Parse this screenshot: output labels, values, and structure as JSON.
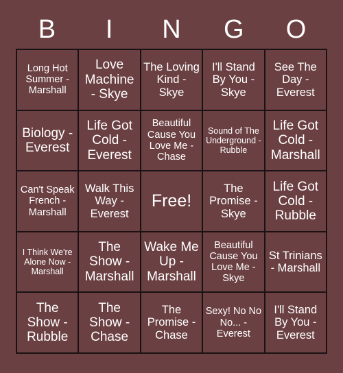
{
  "card": {
    "header_letters": [
      "B",
      "I",
      "N",
      "G",
      "O"
    ],
    "colors": {
      "background": "#6b4042",
      "cell_background": "#6b4042",
      "grid_line": "#191113",
      "text": "#ffffff"
    },
    "cells": [
      {
        "text": "Long Hot Summer - Marshall",
        "size": "sm"
      },
      {
        "text": "Love Machine - Skye",
        "size": "lg"
      },
      {
        "text": "The Loving Kind - Skye",
        "size": "md"
      },
      {
        "text": "I'll Stand By You - Skye",
        "size": "md"
      },
      {
        "text": "See The Day - Everest",
        "size": "md"
      },
      {
        "text": "Biology - Everest",
        "size": "lg"
      },
      {
        "text": "Life Got Cold - Everest",
        "size": "lg"
      },
      {
        "text": "Beautiful Cause You Love Me - Chase",
        "size": "sm"
      },
      {
        "text": "Sound of The Underground - Rubble",
        "size": "xs"
      },
      {
        "text": "Life Got Cold - Marshall",
        "size": "lg"
      },
      {
        "text": "Can't Speak French - Marshall",
        "size": "sm"
      },
      {
        "text": "Walk This Way - Everest",
        "size": "md"
      },
      {
        "text": "Free!",
        "size": "xl"
      },
      {
        "text": "The Promise - Skye",
        "size": "md"
      },
      {
        "text": "Life Got Cold - Rubble",
        "size": "lg"
      },
      {
        "text": "I Think We're Alone Now - Marshall",
        "size": "xs"
      },
      {
        "text": "The Show - Marshall",
        "size": "lg"
      },
      {
        "text": "Wake Me Up - Marshall",
        "size": "lg"
      },
      {
        "text": "Beautiful Cause You Love Me - Skye",
        "size": "sm"
      },
      {
        "text": "St Trinians - Marshall",
        "size": "md"
      },
      {
        "text": "The Show - Rubble",
        "size": "lg"
      },
      {
        "text": "The Show - Chase",
        "size": "lg"
      },
      {
        "text": "The Promise - Chase",
        "size": "md"
      },
      {
        "text": "Sexy! No No No... - Everest",
        "size": "sm"
      },
      {
        "text": "I'll Stand By You - Everest",
        "size": "md"
      }
    ]
  }
}
